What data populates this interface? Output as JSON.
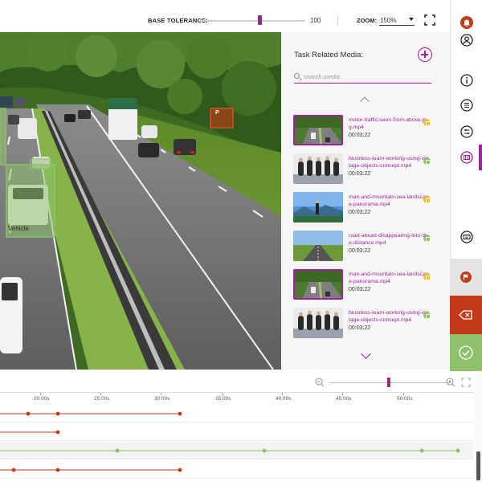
{
  "toolbar": {
    "tolerance_label": "BASE TOLERANCE:",
    "tolerance_value": "100",
    "tolerance_level": 0.56,
    "zoom_label": "ZOOM:",
    "zoom_value": "150%"
  },
  "video": {
    "annotation_label": "Vehicle",
    "sign_text": "P"
  },
  "media_panel": {
    "title": "Task Related Media:",
    "search_placeholder": "search media",
    "items": [
      {
        "name": "motor-traffic-seen-from-above.jpg.mp4",
        "duration": "00:03:22",
        "status_color": "#e8c31a",
        "active": true,
        "thumb": "highway"
      },
      {
        "name": "business-team-working-using-vintage-objects-concept.mp4",
        "duration": "00:03:22",
        "status_color": "#8dc16a",
        "active": false,
        "thumb": "team"
      },
      {
        "name": "man-and-mountain-sea-landscape-panorama.mp4",
        "duration": "00:03:22",
        "status_color": "#e8c31a",
        "active": false,
        "thumb": "mountain"
      },
      {
        "name": "road-ahead-disappearing-into-the-distance.mp4",
        "duration": "00:03:22",
        "status_color": "#8dc16a",
        "active": false,
        "thumb": "road"
      },
      {
        "name": "man-and-mountain-sea-landscape-panorama.mp4",
        "duration": "00:03:22",
        "status_color": "#e8c31a",
        "active": true,
        "thumb": "highway"
      },
      {
        "name": "business-team-working-using-vintage-objects-concept.mp4",
        "duration": "00:03:22",
        "status_color": "#8dc16a",
        "active": false,
        "thumb": "team"
      }
    ]
  },
  "sidebar": {
    "icons": [
      "bell-icon",
      "user-icon",
      "info-icon",
      "list-icon",
      "sliders-icon",
      "film-icon",
      "keyboard-icon"
    ],
    "flag_icon": "flag-icon",
    "reject_icon": "backspace-icon",
    "accept_icon": "check-icon"
  },
  "timeline": {
    "zoom_level": 0.48,
    "ticks": [
      "20:00s",
      "25:00s",
      "30:00s",
      "35:00s",
      "40:00s",
      "45:00s",
      "50:00s"
    ],
    "colors": {
      "red": "#c33a18",
      "green": "#8dc16a",
      "purple": "#a0219e"
    }
  }
}
